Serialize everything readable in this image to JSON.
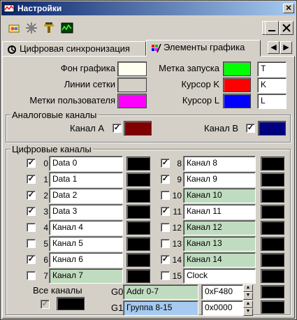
{
  "window": {
    "title": "Настройки",
    "close_label": "✕"
  },
  "tabs": [
    {
      "label": "Цифровая синхронизация"
    },
    {
      "label": "Элементы графика"
    }
  ],
  "tab_nav": {
    "prev": "◀",
    "next": "▶"
  },
  "graph": {
    "background_label": "Фон графика",
    "grid_label": "Линии сетки",
    "user_marks_label": "Метки пользователя",
    "trigger_label": "Метка запуска",
    "trigger_value": "T",
    "cursor_k_label": "Курсор K",
    "cursor_k_value": "K",
    "cursor_l_label": "Курсор L",
    "cursor_l_value": "L"
  },
  "colors": {
    "background": "#fffff0",
    "grid": "#d4d0c8",
    "user_marks": "#ff00ff",
    "trigger": "#00ff00",
    "cursor_k": "#ff0000",
    "cursor_l": "#0000ff",
    "channel_a": "#800000",
    "channel_b": "#000080",
    "digital": "#000000"
  },
  "analog": {
    "title": "Аналоговые каналы",
    "channel_a": "Канал A",
    "channel_b": "Канал B",
    "check": "✓"
  },
  "digital": {
    "title": "Цифровые каналы",
    "channels": [
      {
        "num": "0",
        "name": "Data 0",
        "checked": "✓"
      },
      {
        "num": "1",
        "name": "Data 1",
        "checked": "✓"
      },
      {
        "num": "2",
        "name": "Data 2",
        "checked": "✓"
      },
      {
        "num": "3",
        "name": "Data 3",
        "checked": "✓"
      },
      {
        "num": "4",
        "name": "Канал 4",
        "checked": ""
      },
      {
        "num": "5",
        "name": "Канал 5",
        "checked": ""
      },
      {
        "num": "6",
        "name": "Канал 6",
        "checked": "✓"
      },
      {
        "num": "7",
        "name": "Канал 7",
        "checked": ""
      },
      {
        "num": "8",
        "name": "Канал 8",
        "checked": "✓"
      },
      {
        "num": "9",
        "name": "Канал 9",
        "checked": "✓"
      },
      {
        "num": "10",
        "name": "Канал 10",
        "checked": ""
      },
      {
        "num": "11",
        "name": "Канал 11",
        "checked": "✓"
      },
      {
        "num": "12",
        "name": "Канал 12",
        "checked": ""
      },
      {
        "num": "13",
        "name": "Канал 13",
        "checked": ""
      },
      {
        "num": "14",
        "name": "Канал 14",
        "checked": "✓"
      },
      {
        "num": "15",
        "name": "Clock",
        "checked": ""
      }
    ],
    "all_label": "Все каналы",
    "all_check": "✓",
    "groups": [
      {
        "label": "G0",
        "name": "Addr 0-7",
        "value": "0xF480"
      },
      {
        "label": "G1",
        "name": "Группа 8-15",
        "value": "0x0000"
      }
    ]
  }
}
